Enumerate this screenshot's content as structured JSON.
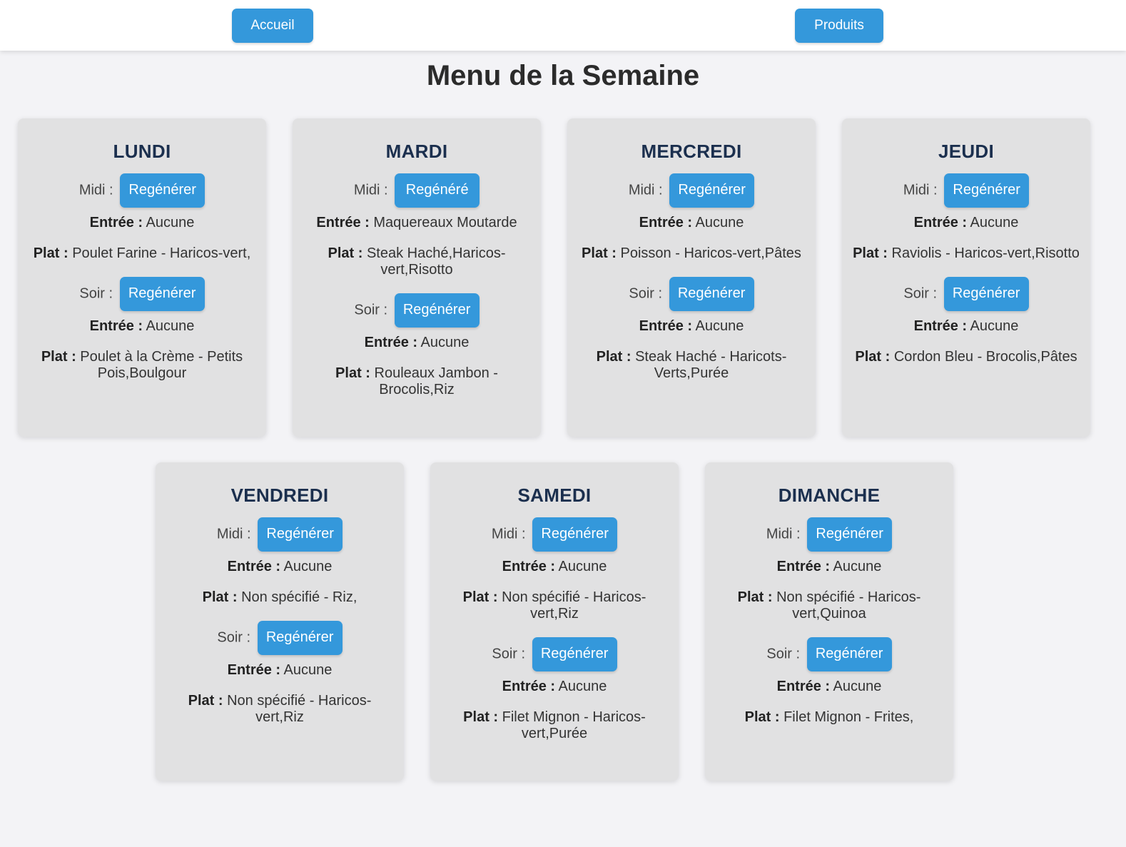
{
  "nav": {
    "home_label": "Accueil",
    "products_label": "Produits"
  },
  "page": {
    "title": "Menu de la Semaine"
  },
  "labels": {
    "midi": "Midi :",
    "soir": "Soir :",
    "entree": "Entrée :",
    "plat": "Plat :"
  },
  "days": [
    {
      "name": "LUNDI",
      "midi": {
        "button": "Regénérer",
        "entree": "Aucune",
        "plat": "Poulet Farine - Haricos-vert,"
      },
      "soir": {
        "button": "Regénérer",
        "entree": "Aucune",
        "plat": "Poulet à la Crème - Petits Pois,Boulgour"
      }
    },
    {
      "name": "MARDI",
      "midi": {
        "button": "Regénéré",
        "entree": "Maquereaux Moutarde",
        "plat": "Steak Haché,Haricos-vert,Risotto"
      },
      "soir": {
        "button": "Regénérer",
        "entree": "Aucune",
        "plat": "Rouleaux Jambon - Brocolis,Riz"
      }
    },
    {
      "name": "MERCREDI",
      "midi": {
        "button": "Regénérer",
        "entree": "Aucune",
        "plat": "Poisson - Haricos-vert,Pâtes"
      },
      "soir": {
        "button": "Regénérer",
        "entree": "Aucune",
        "plat": "Steak Haché - Haricots-Verts,Purée"
      }
    },
    {
      "name": "JEUDI",
      "midi": {
        "button": "Regénérer",
        "entree": "Aucune",
        "plat": "Raviolis - Haricos-vert,Risotto"
      },
      "soir": {
        "button": "Regénérer",
        "entree": "Aucune",
        "plat": "Cordon Bleu - Brocolis,Pâtes"
      }
    },
    {
      "name": "VENDREDI",
      "midi": {
        "button": "Regénérer",
        "entree": "Aucune",
        "plat": "Non spécifié - Riz,"
      },
      "soir": {
        "button": "Regénérer",
        "entree": "Aucune",
        "plat": "Non spécifié - Haricos-vert,Riz"
      }
    },
    {
      "name": "SAMEDI",
      "midi": {
        "button": "Regénérer",
        "entree": "Aucune",
        "plat": "Non spécifié - Haricos-vert,Riz"
      },
      "soir": {
        "button": "Regénérer",
        "entree": "Aucune",
        "plat": "Filet Mignon - Haricos-vert,Purée"
      }
    },
    {
      "name": "DIMANCHE",
      "midi": {
        "button": "Regénérer",
        "entree": "Aucune",
        "plat": "Non spécifié - Haricos-vert,Quinoa"
      },
      "soir": {
        "button": "Regénérer",
        "entree": "Aucune",
        "plat": "Filet Mignon - Frites,"
      }
    }
  ],
  "colors": {
    "accent": "#3498db",
    "card_bg": "#e1e1e2",
    "day_title": "#1b2f4e",
    "page_bg": "#f3f3f6"
  }
}
